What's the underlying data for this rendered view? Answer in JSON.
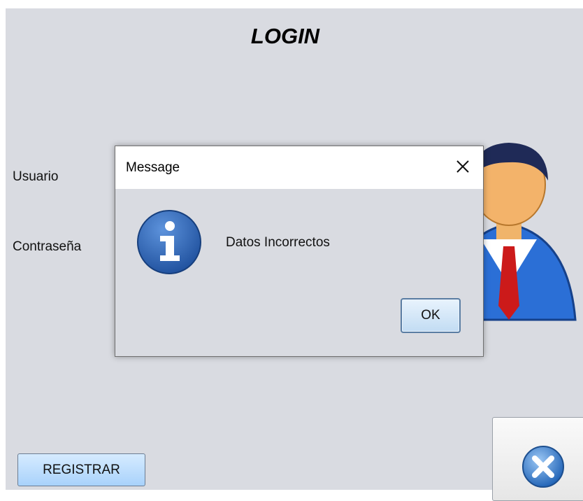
{
  "login": {
    "title": "LOGIN",
    "username_label": "Usuario",
    "password_label": "Contraseña",
    "register_label": "REGISTRAR"
  },
  "dialog": {
    "title": "Message",
    "message": "Datos Incorrectos",
    "ok_label": "OK",
    "close_glyph": "✕",
    "icon": "info-icon"
  },
  "icons": {
    "avatar": "user-avatar-icon",
    "close_app": "close-circle-icon"
  },
  "colors": {
    "window_bg": "#d9dbe1",
    "register_button": "#a8d2fb",
    "info_icon": "#2f66b8",
    "avatar_suit": "#2b6fd6",
    "tie": "#cc1a1a",
    "close_circle": "#3f86d9"
  }
}
